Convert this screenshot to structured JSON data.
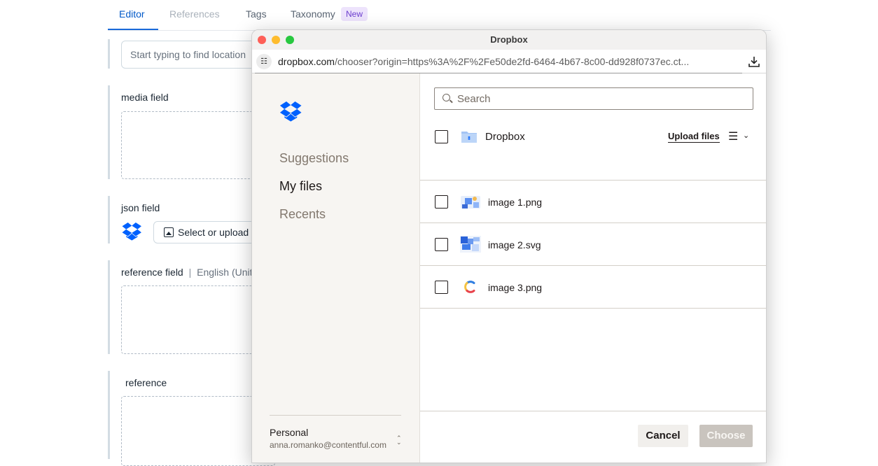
{
  "editor": {
    "tabs": [
      {
        "label": "Editor"
      },
      {
        "label": "References"
      },
      {
        "label": "Tags"
      },
      {
        "label": "Taxonomy"
      }
    ],
    "taxonomy_badge": "New",
    "location_placeholder": "Start typing to find location",
    "media_field_label": "media field",
    "json_field_label": "json field",
    "select_upload_label": "Select or upload",
    "reference_field_label": "reference field",
    "reference_locale_sep": "|",
    "reference_locale": "English (United States)",
    "reference_label": "reference"
  },
  "popup": {
    "window_title": "Dropbox",
    "url_host": "dropbox.com",
    "url_path": "/chooser?origin=https%3A%2F%2Fe50de2fd-6464-4b67-8c00-dd928f0737ec.ct...",
    "sidebar": {
      "nav": [
        {
          "label": "Suggestions",
          "active": false
        },
        {
          "label": "My files",
          "active": true
        },
        {
          "label": "Recents",
          "active": false
        }
      ],
      "account_name": "Personal",
      "account_email": "anna.romanko@contentful.com"
    },
    "search_placeholder": "Search",
    "folder_name": "Dropbox",
    "upload_label": "Upload files",
    "files": [
      {
        "name": "image 1.png"
      },
      {
        "name": "image 2.svg"
      },
      {
        "name": "image 3.png"
      }
    ],
    "cancel_label": "Cancel",
    "choose_label": "Choose"
  },
  "colors": {
    "dropbox_blue": "#0061fe",
    "editor_accent": "#1a6ad9",
    "traffic_red": "#fe5f57",
    "traffic_yellow": "#febc2e",
    "traffic_green": "#28c840"
  }
}
